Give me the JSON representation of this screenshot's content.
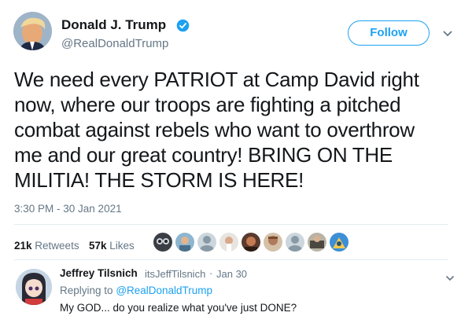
{
  "tweet": {
    "author_name": "Donald J. Trump",
    "author_handle": "@RealDonaldTrump",
    "follow_label": "Follow",
    "text_lines": [
      "We need every PATRIOT at Camp David right",
      "now, where our troops are fighting a pitched",
      "combat against rebels who want to overthrow",
      "me and our great country! BRING ON THE",
      "MILITIA! THE STORM IS HERE!"
    ],
    "timestamp": "3:30 PM - 30 Jan 2021",
    "retweet_count": "21k",
    "retweet_label": "Retweets",
    "like_count": "57k",
    "like_label": "Likes",
    "colors": {
      "accent": "#1da1f2",
      "secondary_text": "#657786",
      "divider": "#e6ecf0"
    }
  },
  "reply": {
    "author_name": "Jeffrey Tilsnich",
    "author_handle": "itsJeffTilsnich",
    "separator": "·",
    "date": "Jan 30",
    "replying_prefix": "Replying to",
    "replying_to": "@RealDonaldTrump",
    "text": "My GOD... do you realize what you've just DONE?"
  },
  "icons": [
    "verified-badge-icon",
    "chevron-down-icon"
  ]
}
